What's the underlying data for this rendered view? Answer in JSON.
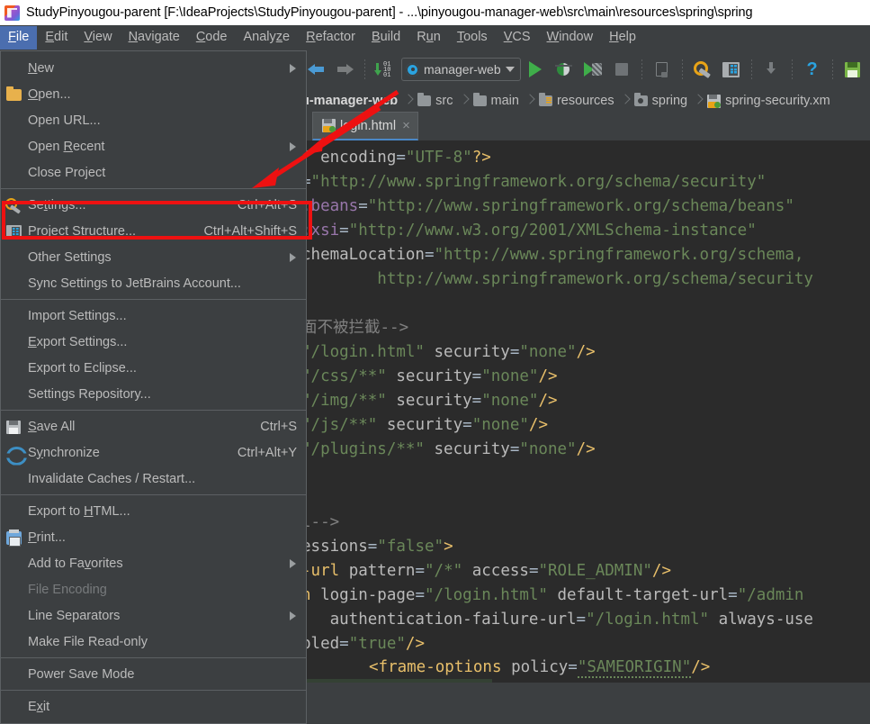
{
  "titlebar": {
    "icon": "intellij-idea-icon",
    "text": "StudyPinyougou-parent [F:\\IdeaProjects\\StudyPinyougou-parent] - ...\\pinyougou-manager-web\\src\\main\\resources\\spring\\spring"
  },
  "menubar": {
    "items": [
      {
        "label": "File",
        "active": true
      },
      {
        "label": "Edit",
        "active": false
      },
      {
        "label": "View",
        "active": false
      },
      {
        "label": "Navigate",
        "active": false
      },
      {
        "label": "Code",
        "active": false
      },
      {
        "label": "Analyze",
        "active": false
      },
      {
        "label": "Refactor",
        "active": false
      },
      {
        "label": "Build",
        "active": false
      },
      {
        "label": "Run",
        "active": false
      },
      {
        "label": "Tools",
        "active": false
      },
      {
        "label": "VCS",
        "active": false
      },
      {
        "label": "Window",
        "active": false
      },
      {
        "label": "Help",
        "active": false
      }
    ]
  },
  "toolbar": {
    "back_icon": "back-arrow-icon",
    "forward_icon": "forward-arrow-icon",
    "update_icon": "update-project-icon",
    "run_config": {
      "label": "manager-web",
      "gear_icon": "gear-icon",
      "caret_icon": "chevron-down-icon"
    },
    "run_icon": "run-icon",
    "debug_icon": "debug-icon",
    "coverage_icon": "run-with-coverage-icon",
    "stop_icon": "stop-icon",
    "app_icon": "application-icon",
    "settings_icon": "settings-wrench-icon",
    "project_structure_icon": "project-structure-icon",
    "get_icon": "update-icon",
    "help_icon": "help-icon",
    "save_icon": "save-all-icon"
  },
  "breadcrumb": {
    "items": [
      {
        "label": "u-manager-web",
        "icon": "module-icon",
        "bold": true
      },
      {
        "label": "src",
        "icon": "folder-icon",
        "bold": false
      },
      {
        "label": "main",
        "icon": "folder-icon",
        "bold": false
      },
      {
        "label": "resources",
        "icon": "resources-folder-icon",
        "bold": false
      },
      {
        "label": "spring",
        "icon": "spring-folder-icon",
        "bold": false
      },
      {
        "label": "spring-security.xm",
        "icon": "xml-file-icon",
        "bold": false
      }
    ]
  },
  "tabs": [
    {
      "label": "login.html",
      "icon": "html-file-icon",
      "close": "×",
      "active": true
    }
  ],
  "file_menu": {
    "items": [
      {
        "label": "New",
        "accel": "",
        "icon": "",
        "submenu": true,
        "disabled": false,
        "mnemonic": "N"
      },
      {
        "label": "Open...",
        "accel": "",
        "icon": "folder-icon",
        "submenu": false,
        "disabled": false,
        "mnemonic": "O"
      },
      {
        "label": "Open URL...",
        "accel": "",
        "icon": "",
        "submenu": false,
        "disabled": false,
        "mnemonic": ""
      },
      {
        "label": "Open Recent",
        "accel": "",
        "icon": "",
        "submenu": true,
        "disabled": false,
        "mnemonic": "R"
      },
      {
        "label": "Close Project",
        "accel": "",
        "icon": "",
        "submenu": false,
        "disabled": false,
        "mnemonic": ""
      },
      {
        "separator": true
      },
      {
        "label": "Settings...",
        "accel": "Ctrl+Alt+S",
        "icon": "settings-wrench-icon",
        "submenu": false,
        "disabled": false,
        "mnemonic": "t"
      },
      {
        "label": "Project Structure...",
        "accel": "Ctrl+Alt+Shift+S",
        "icon": "project-structure-icon",
        "submenu": false,
        "disabled": false,
        "mnemonic": ""
      },
      {
        "label": "Other Settings",
        "accel": "",
        "icon": "",
        "submenu": true,
        "disabled": false,
        "mnemonic": ""
      },
      {
        "label": "Sync Settings to JetBrains Account...",
        "accel": "",
        "icon": "",
        "submenu": false,
        "disabled": false,
        "mnemonic": ""
      },
      {
        "separator": true
      },
      {
        "label": "Import Settings...",
        "accel": "",
        "icon": "",
        "submenu": false,
        "disabled": false,
        "mnemonic": ""
      },
      {
        "label": "Export Settings...",
        "accel": "",
        "icon": "",
        "submenu": false,
        "disabled": false,
        "mnemonic": "E"
      },
      {
        "label": "Export to Eclipse...",
        "accel": "",
        "icon": "",
        "submenu": false,
        "disabled": false,
        "mnemonic": ""
      },
      {
        "label": "Settings Repository...",
        "accel": "",
        "icon": "",
        "submenu": false,
        "disabled": false,
        "mnemonic": ""
      },
      {
        "separator": true
      },
      {
        "label": "Save All",
        "accel": "Ctrl+S",
        "icon": "save-icon",
        "submenu": false,
        "disabled": false,
        "mnemonic": "S"
      },
      {
        "label": "Synchronize",
        "accel": "Ctrl+Alt+Y",
        "icon": "synchronize-icon",
        "submenu": false,
        "disabled": false,
        "mnemonic": "y"
      },
      {
        "label": "Invalidate Caches / Restart...",
        "accel": "",
        "icon": "",
        "submenu": false,
        "disabled": false,
        "mnemonic": ""
      },
      {
        "separator": true
      },
      {
        "label": "Export to HTML...",
        "accel": "",
        "icon": "",
        "submenu": false,
        "disabled": false,
        "mnemonic": "H"
      },
      {
        "label": "Print...",
        "accel": "",
        "icon": "print-icon",
        "submenu": false,
        "disabled": false,
        "mnemonic": "P"
      },
      {
        "label": "Add to Favorites",
        "accel": "",
        "icon": "",
        "submenu": true,
        "disabled": false,
        "mnemonic": "v"
      },
      {
        "label": "File Encoding",
        "accel": "",
        "icon": "",
        "submenu": false,
        "disabled": true,
        "mnemonic": ""
      },
      {
        "label": "Line Separators",
        "accel": "",
        "icon": "",
        "submenu": true,
        "disabled": false,
        "mnemonic": ""
      },
      {
        "label": "Make File Read-only",
        "accel": "",
        "icon": "",
        "submenu": false,
        "disabled": false,
        "mnemonic": ""
      },
      {
        "separator": true
      },
      {
        "label": "Power Save Mode",
        "accel": "",
        "icon": "",
        "submenu": false,
        "disabled": false,
        "mnemonic": ""
      },
      {
        "separator": true
      },
      {
        "label": "Exit",
        "accel": "",
        "icon": "",
        "submenu": false,
        "disabled": false,
        "mnemonic": "x"
      }
    ]
  },
  "editor": {
    "lines": [
      [
        {
          "t": "\" ",
          "c": "plain"
        },
        {
          "t": "encoding",
          "c": "attr"
        },
        {
          "t": "=",
          "c": "punc"
        },
        {
          "t": "\"UTF-8\"",
          "c": "str"
        },
        {
          "t": "?>",
          "c": "tag"
        }
      ],
      [
        {
          "t": "=",
          "c": "punc"
        },
        {
          "t": "\"http://www.springframework.org/schema/security\"",
          "c": "str"
        }
      ],
      [
        {
          "t": ":beans",
          "c": "ns"
        },
        {
          "t": "=",
          "c": "punc"
        },
        {
          "t": "\"http://www.springframework.org/schema/beans\"",
          "c": "str"
        }
      ],
      [
        {
          "t": ":xsi",
          "c": "ns"
        },
        {
          "t": "=",
          "c": "punc"
        },
        {
          "t": "\"http://www.w3.org/2001/XMLSchema-instance\"",
          "c": "str"
        }
      ],
      [
        {
          "t": "chemaLocation",
          "c": "attr"
        },
        {
          "t": "=",
          "c": "punc"
        },
        {
          "t": "\"http://www.springframework.org/schema,",
          "c": "str"
        }
      ],
      [
        {
          "t": "        http://www.springframework.org/schema/security",
          "c": "str"
        }
      ],
      [],
      [
        {
          "t": "面不被拦截",
          "c": "cmt"
        },
        {
          "t": "-->",
          "c": "cmt"
        }
      ],
      [
        {
          "t": "\"/login.html\"",
          "c": "str"
        },
        {
          "t": " ",
          "c": "plain"
        },
        {
          "t": "security",
          "c": "attr"
        },
        {
          "t": "=",
          "c": "punc"
        },
        {
          "t": "\"none\"",
          "c": "str"
        },
        {
          "t": "/>",
          "c": "tag"
        }
      ],
      [
        {
          "t": "\"/css/**\"",
          "c": "str"
        },
        {
          "t": " ",
          "c": "plain"
        },
        {
          "t": "security",
          "c": "attr"
        },
        {
          "t": "=",
          "c": "punc"
        },
        {
          "t": "\"none\"",
          "c": "str"
        },
        {
          "t": "/>",
          "c": "tag"
        }
      ],
      [
        {
          "t": "\"/img/**\"",
          "c": "str"
        },
        {
          "t": " ",
          "c": "plain"
        },
        {
          "t": "security",
          "c": "attr"
        },
        {
          "t": "=",
          "c": "punc"
        },
        {
          "t": "\"none\"",
          "c": "str"
        },
        {
          "t": "/>",
          "c": "tag"
        }
      ],
      [
        {
          "t": "\"/js/**\"",
          "c": "str"
        },
        {
          "t": " ",
          "c": "plain"
        },
        {
          "t": "security",
          "c": "attr"
        },
        {
          "t": "=",
          "c": "punc"
        },
        {
          "t": "\"none\"",
          "c": "str"
        },
        {
          "t": "/>",
          "c": "tag"
        }
      ],
      [
        {
          "t": "\"/plugins/**\"",
          "c": "str"
        },
        {
          "t": " ",
          "c": "plain"
        },
        {
          "t": "security",
          "c": "attr"
        },
        {
          "t": "=",
          "c": "punc"
        },
        {
          "t": "\"none\"",
          "c": "str"
        },
        {
          "t": "/>",
          "c": "tag"
        }
      ],
      [],
      [],
      [
        {
          "t": "l-->",
          "c": "cmt"
        }
      ],
      [
        {
          "t": "essions",
          "c": "attr"
        },
        {
          "t": "=",
          "c": "punc"
        },
        {
          "t": "\"false\"",
          "c": "str"
        },
        {
          "t": ">",
          "c": "tag"
        }
      ],
      [
        {
          "t": "-url",
          "c": "tag"
        },
        {
          "t": " ",
          "c": "plain"
        },
        {
          "t": "pattern",
          "c": "attr"
        },
        {
          "t": "=",
          "c": "punc"
        },
        {
          "t": "\"/*\"",
          "c": "str"
        },
        {
          "t": " ",
          "c": "plain"
        },
        {
          "t": "access",
          "c": "attr"
        },
        {
          "t": "=",
          "c": "punc"
        },
        {
          "t": "\"ROLE_ADMIN\"",
          "c": "str"
        },
        {
          "t": "/>",
          "c": "tag"
        }
      ],
      [
        {
          "t": "n",
          "c": "tag"
        },
        {
          "t": " ",
          "c": "plain"
        },
        {
          "t": "login-page",
          "c": "attr"
        },
        {
          "t": "=",
          "c": "punc"
        },
        {
          "t": "\"/login.html\"",
          "c": "str"
        },
        {
          "t": " ",
          "c": "plain"
        },
        {
          "t": "default-target-url",
          "c": "attr"
        },
        {
          "t": "=",
          "c": "punc"
        },
        {
          "t": "\"/admin",
          "c": "str"
        }
      ],
      [
        {
          "t": "   ",
          "c": "plain"
        },
        {
          "t": "authentication-failure-url",
          "c": "attr"
        },
        {
          "t": "=",
          "c": "punc"
        },
        {
          "t": "\"/login.html\"",
          "c": "str"
        },
        {
          "t": " ",
          "c": "plain"
        },
        {
          "t": "always-use",
          "c": "attr"
        }
      ],
      [
        {
          "t": "bled",
          "c": "attr"
        },
        {
          "t": "=",
          "c": "punc"
        },
        {
          "t": "\"true\"",
          "c": "str"
        },
        {
          "t": "/>",
          "c": "tag"
        }
      ]
    ],
    "bottom_line_number": "22",
    "bottom_line": [
      {
        "t": "<frame-options",
        "c": "tag"
      },
      {
        "t": " ",
        "c": "plain"
      },
      {
        "t": "policy",
        "c": "attr"
      },
      {
        "t": "=",
        "c": "punc"
      },
      {
        "t": "\"SAMEORIGIN\"",
        "c": "str-sq"
      },
      {
        "t": "/>",
        "c": "tag"
      }
    ]
  },
  "annotations": {
    "highlight_box": "project-structure-highlight",
    "arrow_color": "#ee1111",
    "box_color": "#ee1111"
  }
}
